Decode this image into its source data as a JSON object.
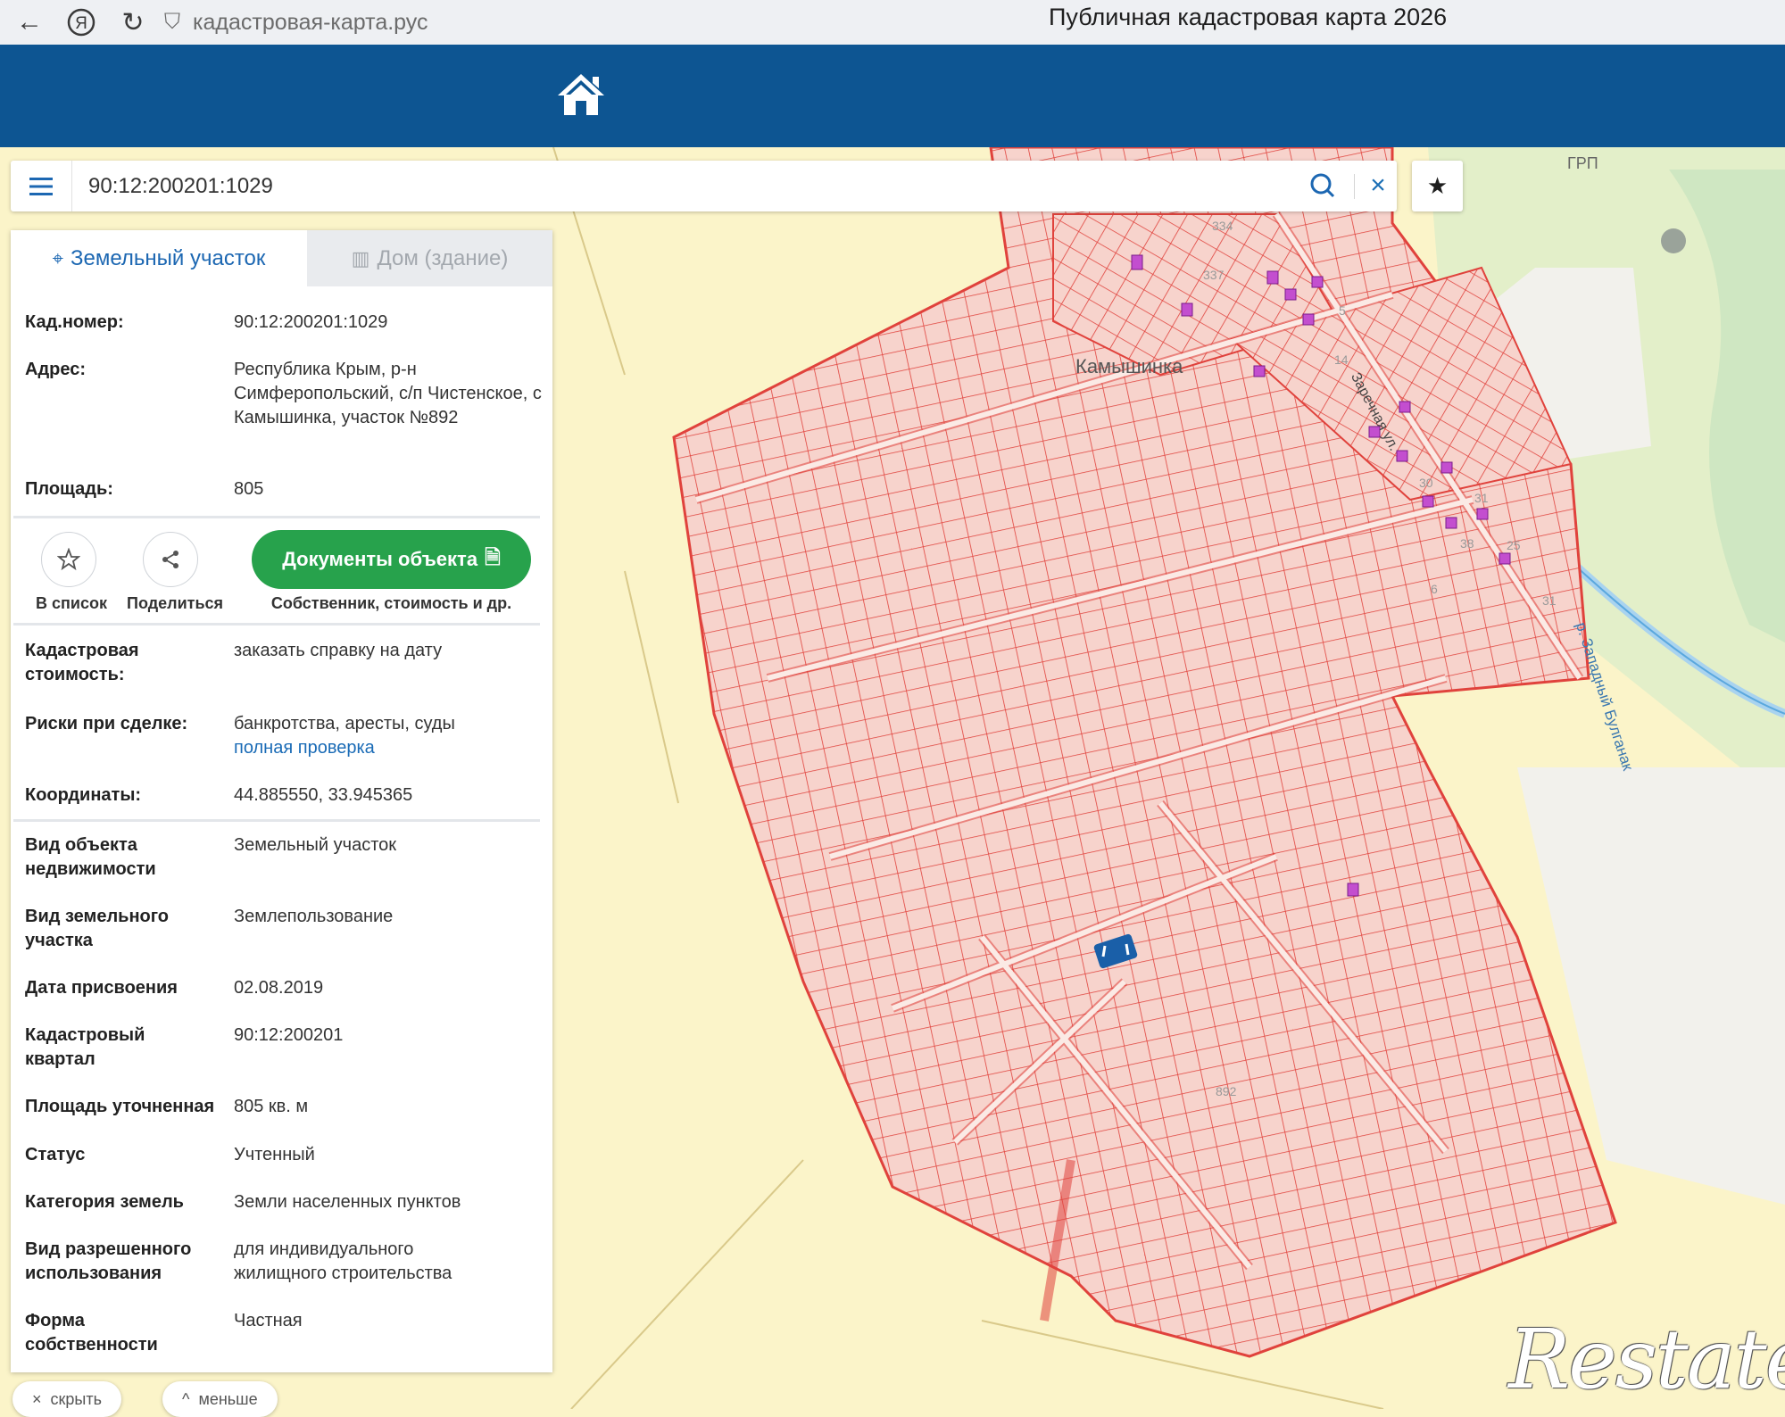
{
  "browser": {
    "url": "кадастровая-карта.рус",
    "tab_title": "Публичная кадастровая карта 2026"
  },
  "search": {
    "value": "90:12:200201:1029"
  },
  "map_labels": {
    "village": "Камышинка",
    "grp": "ГРП",
    "river": "р. Западный Булганак",
    "street": "Заречная ул.",
    "plots": [
      "334",
      "337",
      "5",
      "14",
      "30",
      "31",
      "38",
      "25",
      "6",
      "31",
      "892"
    ]
  },
  "panel": {
    "tabs": {
      "land": "Земельный участок",
      "building": "Дом (здание)"
    },
    "fields": {
      "cad_number_label": "Кад.номер:",
      "cad_number_value": "90:12:200201:1029",
      "address_label": "Адрес:",
      "address_value": "Республика Крым, р-н Симферопольский, с/п Чистенское, с Камышинка, участок №892",
      "area_label": "Площадь:",
      "area_value": "805"
    },
    "actions": {
      "add_to_list": "В список",
      "share": "Поделиться",
      "documents": "Документы объекта",
      "documents_sub": "Собственник, стоимость и др."
    },
    "details": {
      "cad_cost_label": "Кадастровая стоимость:",
      "cad_cost_value": "заказать справку на дату",
      "risks_label": "Риски при сделке:",
      "risks_value": "банкротства, аресты, суды",
      "risks_link": "полная проверка",
      "coords_label": "Координаты:",
      "coords_value": "44.885550, 33.945365",
      "obj_type_label": "Вид объекта недвижимости",
      "obj_type_value": "Земельный участок",
      "land_type_label": "Вид земельного участка",
      "land_type_value": "Землепользование",
      "date_label": "Дата присвоения",
      "date_value": "02.08.2019",
      "quarter_label": "Кадастровый квартал",
      "quarter_value": "90:12:200201",
      "area_precise_label": "Площадь уточненная",
      "area_precise_value": "805 кв. м",
      "status_label": "Статус",
      "status_value": "Учтенный",
      "category_label": "Категория земель",
      "category_value": "Земли населенных пунктов",
      "permitted_label": "Вид разрешенного использования",
      "permitted_value": "для индивидуального жилищного строительства",
      "ownership_label": "Форма собственности",
      "ownership_value": "Частная"
    }
  },
  "bottom": {
    "hide": "скрыть",
    "less": "меньше"
  },
  "watermark": "Restate",
  "colors": {
    "header_blue": "#0d5592",
    "link_blue": "#1a6bb6",
    "docs_green": "#27a24c",
    "parcel_fill": "#f7d3cc",
    "parcel_line": "#e0423c",
    "map_bg": "#fbf4c9"
  }
}
